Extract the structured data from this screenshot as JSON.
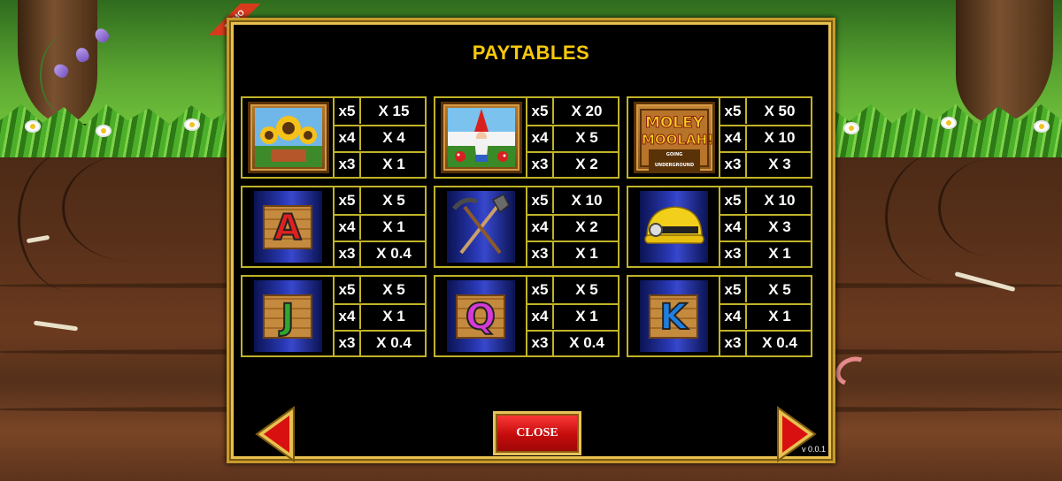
{
  "badge": "DEMO",
  "title": "PAYTABLES",
  "symbols": [
    {
      "id": "sunflowers-icon",
      "rows": [
        {
          "count": "x5",
          "pay": "X 15"
        },
        {
          "count": "x4",
          "pay": "X 4"
        },
        {
          "count": "x3",
          "pay": "X 1"
        }
      ]
    },
    {
      "id": "gnome-icon",
      "rows": [
        {
          "count": "x5",
          "pay": "X 20"
        },
        {
          "count": "x4",
          "pay": "X 5"
        },
        {
          "count": "x3",
          "pay": "X 2"
        }
      ]
    },
    {
      "id": "moley-moolah-logo",
      "logo_lines": [
        "MOLEY",
        "MOOLAH!",
        "GOING UNDERGROUND"
      ],
      "rows": [
        {
          "count": "x5",
          "pay": "X 50"
        },
        {
          "count": "x4",
          "pay": "X 10"
        },
        {
          "count": "x3",
          "pay": "X 3"
        }
      ]
    },
    {
      "id": "letter-a-icon",
      "letter": "A",
      "color": "#e02020",
      "rows": [
        {
          "count": "x5",
          "pay": "X 5"
        },
        {
          "count": "x4",
          "pay": "X 1"
        },
        {
          "count": "x3",
          "pay": "X 0.4"
        }
      ]
    },
    {
      "id": "pickaxe-shovel-icon",
      "rows": [
        {
          "count": "x5",
          "pay": "X 10"
        },
        {
          "count": "x4",
          "pay": "X 2"
        },
        {
          "count": "x3",
          "pay": "X 1"
        }
      ]
    },
    {
      "id": "miner-helmet-icon",
      "rows": [
        {
          "count": "x5",
          "pay": "X 10"
        },
        {
          "count": "x4",
          "pay": "X 3"
        },
        {
          "count": "x3",
          "pay": "X 1"
        }
      ]
    },
    {
      "id": "letter-j-icon",
      "letter": "J",
      "color": "#2ea82e",
      "rows": [
        {
          "count": "x5",
          "pay": "X 5"
        },
        {
          "count": "x4",
          "pay": "X 1"
        },
        {
          "count": "x3",
          "pay": "X 0.4"
        }
      ]
    },
    {
      "id": "letter-q-icon",
      "letter": "Q",
      "color": "#d63ad6",
      "rows": [
        {
          "count": "x5",
          "pay": "X 5"
        },
        {
          "count": "x4",
          "pay": "X 1"
        },
        {
          "count": "x3",
          "pay": "X 0.4"
        }
      ]
    },
    {
      "id": "letter-k-icon",
      "letter": "K",
      "color": "#1f7fe0",
      "rows": [
        {
          "count": "x5",
          "pay": "X 5"
        },
        {
          "count": "x4",
          "pay": "X 1"
        },
        {
          "count": "x3",
          "pay": "X 0.4"
        }
      ]
    }
  ],
  "buttons": {
    "close": "CLOSE",
    "prev": "previous-page-arrow",
    "next": "next-page-arrow"
  },
  "version": "v 0.0.1",
  "colors": {
    "title": "#f7c90b",
    "grid": "#c1b328",
    "close_bg": "#d11212",
    "frame": "#c89a2a"
  }
}
